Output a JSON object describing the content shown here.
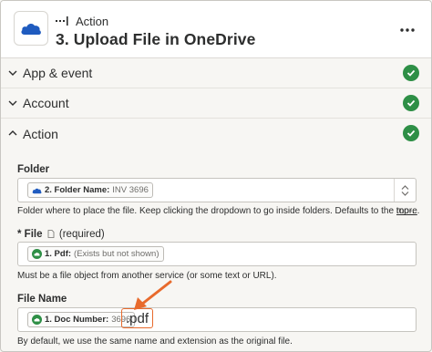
{
  "header": {
    "step_type": "Action",
    "step_title": "3. Upload File in OneDrive",
    "app_icon": "onedrive-cloud-icon",
    "more_icon": "more-horizontal-icon"
  },
  "sections": [
    {
      "label": "App & event",
      "status_icon": "check-circle-icon"
    },
    {
      "label": "Account",
      "status_icon": "check-circle-icon"
    },
    {
      "label": "Action",
      "status_icon": "check-circle-icon"
    }
  ],
  "fields": {
    "folder": {
      "label": "Folder",
      "pill_name": "2. Folder Name:",
      "pill_value": "INV 3696",
      "help": "Folder where to place the file. Keep clicking the dropdown to go inside folders. Defaults to the top-...",
      "more": "more"
    },
    "file": {
      "label": "File",
      "required": "(required)",
      "pill_name": "1. Pdf:",
      "pill_value": "(Exists but not shown)",
      "help": "Must be a file object from another service (or some text or URL)."
    },
    "file_name": {
      "label": "File Name",
      "pill_name": "1. Doc Number:",
      "pill_value": "3696",
      "extension": ".pdf",
      "help": "By default, we use the same name and extension as the original file."
    }
  },
  "colors": {
    "accent_green": "#2e8f46",
    "onedrive_blue": "#1f5bbf",
    "annotation_orange": "#e86a2c"
  }
}
